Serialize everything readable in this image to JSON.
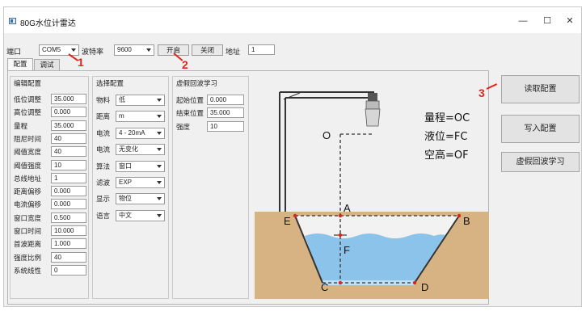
{
  "window": {
    "title": "80G水位计雷达",
    "minimize": "—",
    "maximize": "☐",
    "close": "✕"
  },
  "connection": {
    "port_label": "端口",
    "port_value": "COM5",
    "baud_label": "波特率",
    "baud_value": "9600",
    "open_button": "开启",
    "close_button": "关闭",
    "address_label": "地址",
    "address_value": "1"
  },
  "tabs": [
    {
      "label": "配置"
    },
    {
      "label": "调试"
    }
  ],
  "edit_config": {
    "title": "编辑配置",
    "rows": [
      {
        "label": "低位调整",
        "value": "35.000"
      },
      {
        "label": "高位调整",
        "value": "0.000"
      },
      {
        "label": "量程",
        "value": "35.000"
      },
      {
        "label": "阻尼时间",
        "value": "40"
      },
      {
        "label": "阈值宽度",
        "value": "40"
      },
      {
        "label": "阈值强度",
        "value": "10"
      },
      {
        "label": "总线地址",
        "value": "1"
      },
      {
        "label": "距离偏移",
        "value": "0.000"
      },
      {
        "label": "电流偏移",
        "value": "0.000"
      },
      {
        "label": "窗口宽度",
        "value": "0.500"
      },
      {
        "label": "窗口时间",
        "value": "10.000"
      },
      {
        "label": "首波距离",
        "value": "1.000"
      },
      {
        "label": "强度比例",
        "value": "40"
      },
      {
        "label": "系统线性",
        "value": "0"
      }
    ]
  },
  "select_config": {
    "title": "选择配置",
    "rows": [
      {
        "label": "物料",
        "value": "低"
      },
      {
        "label": "距离",
        "value": "m"
      },
      {
        "label": "电流",
        "value": "4 - 20mA"
      },
      {
        "label": "电流",
        "value": "无变化"
      },
      {
        "label": "算法",
        "value": "窗口"
      },
      {
        "label": "滤波",
        "value": "EXP"
      },
      {
        "label": "显示",
        "value": "物位"
      },
      {
        "label": "语言",
        "value": "中文"
      }
    ]
  },
  "false_echo": {
    "title": "虚假回波学习",
    "rows": [
      {
        "label": "起始位置",
        "value": "0.000"
      },
      {
        "label": "结束位置",
        "value": "35.000"
      },
      {
        "label": "强度",
        "value": "10"
      }
    ]
  },
  "diagram": {
    "range_text": "量程=OC",
    "level_text": "液位=FC",
    "empty_text": "空高=OF",
    "point_o": "O",
    "point_a": "A",
    "point_b": "B",
    "point_c": "C",
    "point_d": "D",
    "point_e": "E",
    "point_f": "F"
  },
  "actions": {
    "read_config": "读取配置",
    "write_config": "写入配置",
    "false_echo_learn": "虚假回波学习"
  },
  "annotations": {
    "one": "1",
    "two": "2",
    "three": "3"
  },
  "colors": {
    "annotation_red": "#e0241b",
    "ground": "#d7b383",
    "water": "#8cc3ea"
  }
}
